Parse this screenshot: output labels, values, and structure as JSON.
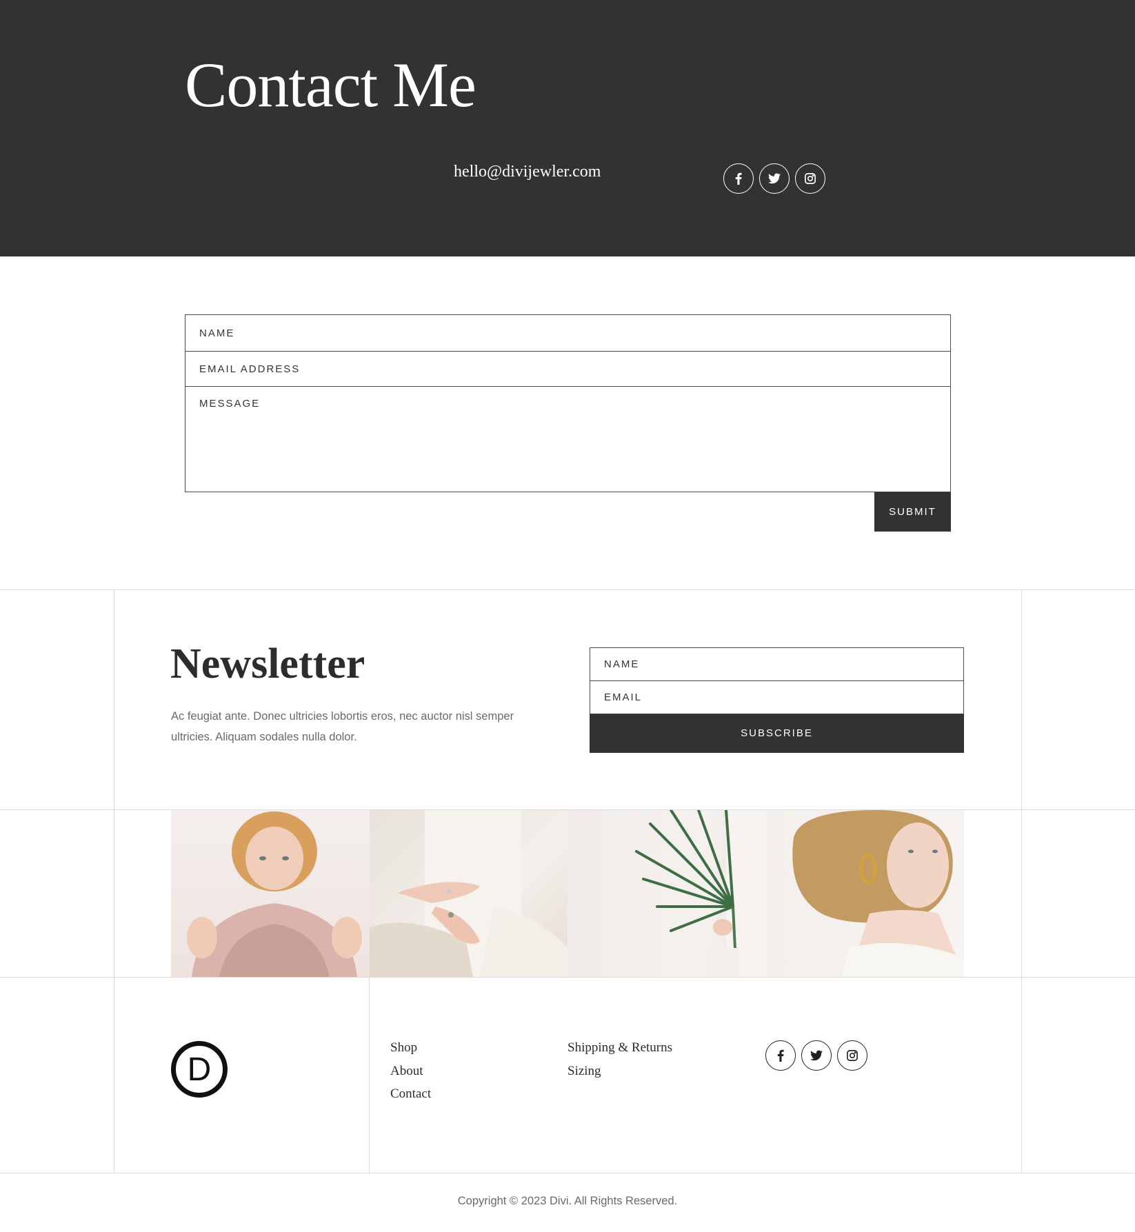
{
  "hero": {
    "title": "Contact Me",
    "email": "hello@divijewler.com",
    "background_color": "#323232",
    "social": [
      {
        "icon": "facebook-icon"
      },
      {
        "icon": "twitter-icon"
      },
      {
        "icon": "instagram-icon"
      }
    ]
  },
  "contact_form": {
    "name_placeholder": "NAME",
    "email_placeholder": "EMAIL ADDRESS",
    "message_placeholder": "MESSAGE",
    "submit_label": "SUBMIT"
  },
  "newsletter": {
    "title": "Newsletter",
    "text": "Ac feugiat ante. Donec ultricies lobortis eros, nec auctor nisl semper ultricies. Aliquam sodales nulla dolor.",
    "name_placeholder": "NAME",
    "email_placeholder": "EMAIL",
    "subscribe_label": "SUBSCRIBE"
  },
  "gallery": [
    {
      "name": "woman-with-pink-hat-photo"
    },
    {
      "name": "hands-with-rings-photo"
    },
    {
      "name": "palm-leaf-photo"
    },
    {
      "name": "woman-with-gold-earring-photo"
    }
  ],
  "footer": {
    "logo_letter": "D",
    "links_col1": [
      "Shop",
      "About",
      "Contact"
    ],
    "links_col2": [
      "Shipping & Returns",
      "Sizing"
    ],
    "copyright": "Copyright © 2023 Divi. All Rights Reserved."
  }
}
